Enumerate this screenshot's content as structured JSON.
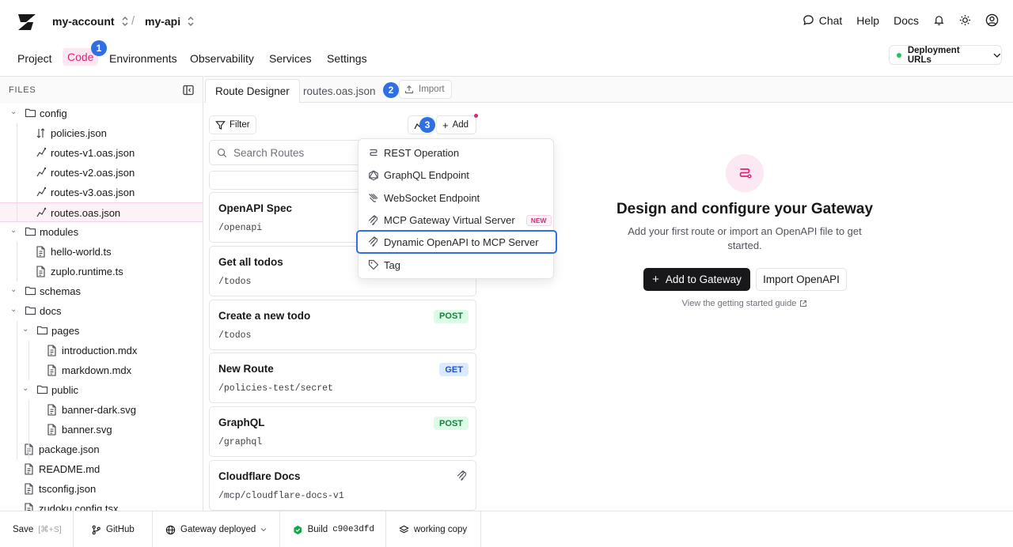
{
  "header": {
    "account": "my-account",
    "project": "my-api",
    "right_items": [
      "Chat",
      "Help",
      "Docs"
    ]
  },
  "nav": {
    "items": [
      "Project",
      "Code",
      "Environments",
      "Observability",
      "Services",
      "Settings"
    ],
    "active": "Code",
    "deployment_button": "Deployment URLs"
  },
  "step_badges": [
    "1",
    "2",
    "3"
  ],
  "sidebar": {
    "title": "FILES",
    "tree": [
      {
        "label": "config",
        "type": "folder",
        "depth": 0
      },
      {
        "label": "policies.json",
        "type": "policy",
        "depth": 1
      },
      {
        "label": "routes-v1.oas.json",
        "type": "route",
        "depth": 1
      },
      {
        "label": "routes-v2.oas.json",
        "type": "route",
        "depth": 1
      },
      {
        "label": "routes-v3.oas.json",
        "type": "route",
        "depth": 1
      },
      {
        "label": "routes.oas.json",
        "type": "route",
        "depth": 1,
        "active": true
      },
      {
        "label": "modules",
        "type": "folder",
        "depth": 0
      },
      {
        "label": "hello-world.ts",
        "type": "file",
        "depth": 1
      },
      {
        "label": "zuplo.runtime.ts",
        "type": "file",
        "depth": 1
      },
      {
        "label": "schemas",
        "type": "folder",
        "depth": 0
      },
      {
        "label": "docs",
        "type": "folder",
        "depth": 0
      },
      {
        "label": "pages",
        "type": "folder",
        "depth": 1
      },
      {
        "label": "introduction.mdx",
        "type": "file",
        "depth": 2
      },
      {
        "label": "markdown.mdx",
        "type": "file",
        "depth": 2
      },
      {
        "label": "public",
        "type": "folder",
        "depth": 1
      },
      {
        "label": "banner-dark.svg",
        "type": "file",
        "depth": 2
      },
      {
        "label": "banner.svg",
        "type": "file",
        "depth": 2
      },
      {
        "label": "package.json",
        "type": "file",
        "depth": 0
      },
      {
        "label": "README.md",
        "type": "file",
        "depth": 0
      },
      {
        "label": "tsconfig.json",
        "type": "file",
        "depth": 0
      },
      {
        "label": "zudoku.config.tsx",
        "type": "file",
        "depth": 0
      }
    ]
  },
  "tabs": {
    "route_designer": "Route Designer",
    "file": "routes.oas.json",
    "import": "Import"
  },
  "routes_panel": {
    "filter": "Filter",
    "add": "Add",
    "search_placeholder": "Search Routes",
    "cards": [
      {
        "title": "OpenAPI Spec",
        "path": "/openapi",
        "method": ""
      },
      {
        "title": "Get all todos",
        "path": "/todos",
        "method": ""
      },
      {
        "title": "Create a new todo",
        "path": "/todos",
        "method": "POST"
      },
      {
        "title": "New Route",
        "path": "/policies-test/secret",
        "method": "GET"
      },
      {
        "title": "GraphQL",
        "path": "/graphql",
        "method": "POST"
      },
      {
        "title": "Cloudflare Docs",
        "path": "/mcp/cloudflare-docs-v1",
        "method": ""
      }
    ]
  },
  "add_menu": {
    "items": [
      {
        "label": "REST Operation",
        "icon": "rest-icon"
      },
      {
        "label": "GraphQL Endpoint",
        "icon": "graphql-icon"
      },
      {
        "label": "WebSocket Endpoint",
        "icon": "websocket-icon"
      },
      {
        "label": "MCP Gateway Virtual Server",
        "icon": "mcp-icon",
        "badge": "NEW"
      },
      {
        "label": "Dynamic OpenAPI to MCP Server",
        "icon": "mcp-icon",
        "highlighted": true
      },
      {
        "label": "Tag",
        "icon": "tag-icon"
      }
    ]
  },
  "empty_state": {
    "title": "Design and configure your Gateway",
    "subtitle": "Add your first route or import an OpenAPI file to get started.",
    "primary": "Add to Gateway",
    "secondary": "Import OpenAPI",
    "guide": "View the getting started guide"
  },
  "footer": {
    "save": "Save",
    "save_shortcut": "[⌘+S]",
    "github": "GitHub",
    "deploy_status": "Gateway deployed",
    "build_label": "Build",
    "build_hash": "c90e3dfd",
    "working_copy": "working copy"
  },
  "colors": {
    "accent_pink": "#db2777",
    "step_badge_blue": "#2f6fe4",
    "post_green": "#15803d",
    "get_blue": "#1d4ed8"
  }
}
